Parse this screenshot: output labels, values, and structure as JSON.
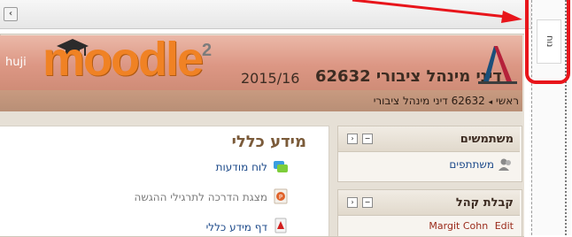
{
  "side_panel": {
    "tab_label": "נוח"
  },
  "header": {
    "institution": "huji",
    "logo_text": "moodle",
    "logo_sup": "2",
    "year": "2015/16",
    "course_title": "דיני מינהל ציבורי 62632"
  },
  "breadcrumb": {
    "items": [
      "ראשי",
      "62632 דיני מינהל ציבורי"
    ],
    "separator": "◂"
  },
  "main": {
    "section_title": "מידע כללי",
    "resources": [
      {
        "label": "לוח מודעות",
        "icon": "forum-icon"
      },
      {
        "label": "מצגת הדרכה לתרגילי ההגשה",
        "icon": "powerpoint-icon"
      },
      {
        "label": "דף מידע כללי",
        "icon": "pdf-icon"
      }
    ]
  },
  "blocks": [
    {
      "title": "משתמשים",
      "items": [
        {
          "label": "משתתפים",
          "icon": "users-icon"
        }
      ]
    },
    {
      "title": "קבלת קהל",
      "items": [
        {
          "label": "Margit Cohn",
          "action": "Edit"
        }
      ]
    }
  ],
  "colors": {
    "accent_red": "#e8151b",
    "moodle_orange": "#f08224",
    "header_top": "#ebb8a8",
    "link_blue": "#1d4a8a"
  }
}
